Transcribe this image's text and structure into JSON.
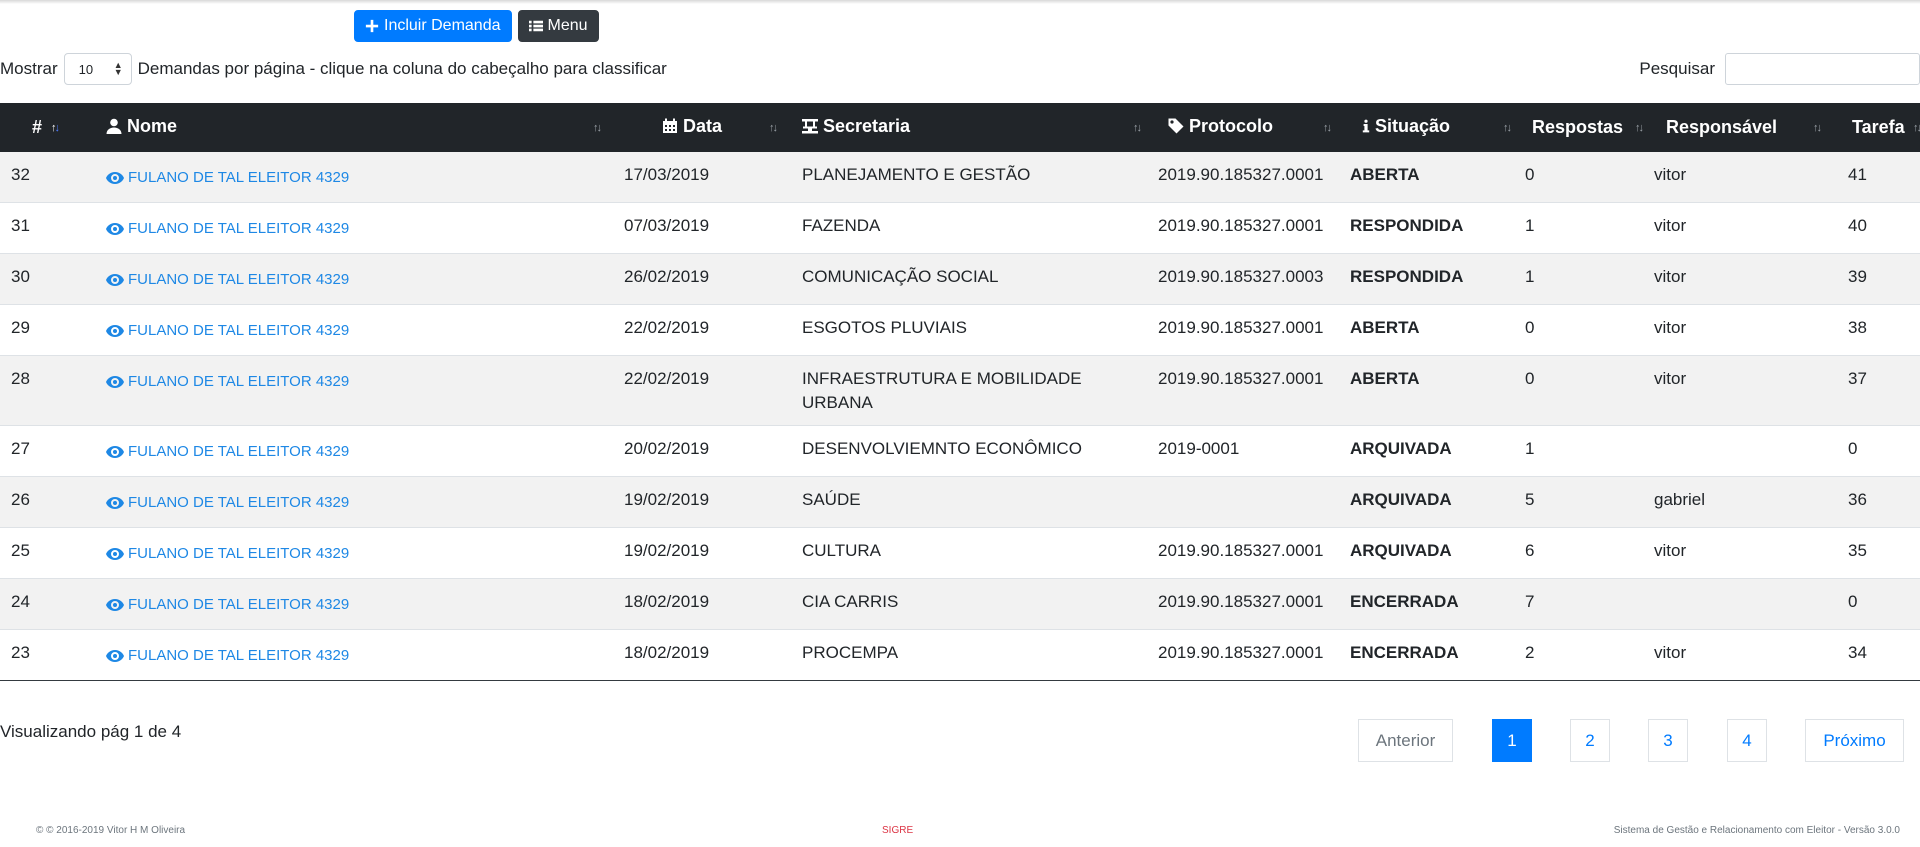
{
  "toolbar": {
    "add_label": "Incluir Demanda",
    "menu_label": "Menu"
  },
  "controls": {
    "show_label": "Mostrar",
    "page_length": "10",
    "per_page_text": "Demandas por página - clique na coluna do cabeçalho para classificar",
    "search_label": "Pesquisar",
    "search_value": ""
  },
  "table": {
    "headers": [
      "#",
      "Nome",
      "Data",
      "Secretaria",
      "Protocolo",
      "Situação",
      "Respostas",
      "Responsável",
      "Tarefa"
    ],
    "rows": [
      {
        "id": "32",
        "name": "FULANO DE TAL ELEITOR 4329",
        "date": "17/03/2019",
        "secretaria": "PLANEJAMENTO E GESTÃO",
        "protocolo": "2019.90.185327.0001",
        "situacao": "ABERTA",
        "respostas": "0",
        "responsavel": "vitor",
        "tarefa": "41"
      },
      {
        "id": "31",
        "name": "FULANO DE TAL ELEITOR 4329",
        "date": "07/03/2019",
        "secretaria": "FAZENDA",
        "protocolo": "2019.90.185327.0001",
        "situacao": "RESPONDIDA",
        "respostas": "1",
        "responsavel": "vitor",
        "tarefa": "40"
      },
      {
        "id": "30",
        "name": "FULANO DE TAL ELEITOR 4329",
        "date": "26/02/2019",
        "secretaria": "COMUNICAÇÃO SOCIAL",
        "protocolo": "2019.90.185327.0003",
        "situacao": "RESPONDIDA",
        "respostas": "1",
        "responsavel": "vitor",
        "tarefa": "39"
      },
      {
        "id": "29",
        "name": "FULANO DE TAL ELEITOR 4329",
        "date": "22/02/2019",
        "secretaria": "ESGOTOS PLUVIAIS",
        "protocolo": "2019.90.185327.0001",
        "situacao": "ABERTA",
        "respostas": "0",
        "responsavel": "vitor",
        "tarefa": "38"
      },
      {
        "id": "28",
        "name": "FULANO DE TAL ELEITOR 4329",
        "date": "22/02/2019",
        "secretaria": "INFRAESTRUTURA E MOBILIDADE URBANA",
        "protocolo": "2019.90.185327.0001",
        "situacao": "ABERTA",
        "respostas": "0",
        "responsavel": "vitor",
        "tarefa": "37"
      },
      {
        "id": "27",
        "name": "FULANO DE TAL ELEITOR 4329",
        "date": "20/02/2019",
        "secretaria": "DESENVOLVIEMNTO ECONÔMICO",
        "protocolo": "2019-0001",
        "situacao": "ARQUIVADA",
        "respostas": "1",
        "responsavel": "",
        "tarefa": "0"
      },
      {
        "id": "26",
        "name": "FULANO DE TAL ELEITOR 4329",
        "date": "19/02/2019",
        "secretaria": "SAÚDE",
        "protocolo": "",
        "situacao": "ARQUIVADA",
        "respostas": "5",
        "responsavel": "gabriel",
        "tarefa": "36"
      },
      {
        "id": "25",
        "name": "FULANO DE TAL ELEITOR 4329",
        "date": "19/02/2019",
        "secretaria": "CULTURA",
        "protocolo": "2019.90.185327.0001",
        "situacao": "ARQUIVADA",
        "respostas": "6",
        "responsavel": "vitor",
        "tarefa": "35"
      },
      {
        "id": "24",
        "name": "FULANO DE TAL ELEITOR 4329",
        "date": "18/02/2019",
        "secretaria": "CIA CARRIS",
        "protocolo": "2019.90.185327.0001",
        "situacao": "ENCERRADA",
        "respostas": "7",
        "responsavel": "",
        "tarefa": "0"
      },
      {
        "id": "23",
        "name": "FULANO DE TAL ELEITOR 4329",
        "date": "18/02/2019",
        "secretaria": "PROCEMPA",
        "protocolo": "2019.90.185327.0001",
        "situacao": "ENCERRADA",
        "respostas": "2",
        "responsavel": "vitor",
        "tarefa": "34"
      }
    ]
  },
  "pagination": {
    "info": "Visualizando pág 1 de 4",
    "previous": "Anterior",
    "pages": [
      "1",
      "2",
      "3",
      "4"
    ],
    "current_page": "1",
    "next": "Próximo"
  },
  "footer": {
    "copyright": "© © 2016-2019 Vitor H M Oliveira",
    "app_name": "SIGRE",
    "system": "Sistema de Gestão e Relacionamento com Eleitor - Versão 3.0.0"
  },
  "colors": {
    "accent": "#007bff",
    "header_bg": "#212529",
    "link": "#1e88e5",
    "brand_red": "#dc3545"
  },
  "icons": {
    "add": "plus-icon",
    "menu": "list-icon",
    "nome": "user-icon",
    "data": "calendar-icon",
    "secretaria": "building-icon",
    "protocolo": "tag-icon",
    "situacao": "info-icon",
    "view": "eye-icon"
  }
}
